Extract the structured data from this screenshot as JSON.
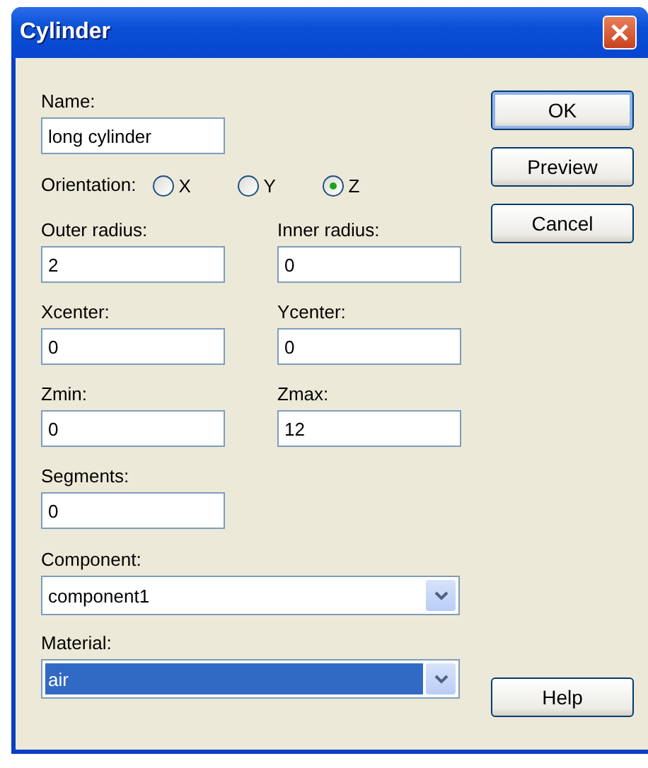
{
  "window": {
    "title": "Cylinder"
  },
  "rows": [
    {
      "kind": "field",
      "label": "Name:",
      "value": "long cylinder"
    },
    {
      "kind": "radio",
      "label": "Orientation:",
      "options": [
        {
          "label": "X",
          "selected": false
        },
        {
          "label": "Y",
          "selected": false
        },
        {
          "label": "Z",
          "selected": true
        }
      ]
    },
    {
      "kind": "pair",
      "fields": [
        {
          "label": "Outer radius:",
          "value": "2"
        },
        {
          "label": "Inner radius:",
          "value": "0"
        }
      ]
    },
    {
      "kind": "pair",
      "fields": [
        {
          "label": "Xcenter:",
          "value": "0"
        },
        {
          "label": "Ycenter:",
          "value": "0"
        }
      ]
    },
    {
      "kind": "pair",
      "fields": [
        {
          "label": "Zmin:",
          "value": "0"
        },
        {
          "label": "Zmax:",
          "value": "12"
        }
      ]
    },
    {
      "kind": "field",
      "label": "Segments:",
      "value": "0"
    },
    {
      "kind": "combo",
      "label": "Component:",
      "value": "component1",
      "focused": false
    },
    {
      "kind": "combo",
      "label": "Material:",
      "value": "air",
      "focused": true
    }
  ],
  "buttons": [
    {
      "label": "OK",
      "default": true
    },
    {
      "label": "Preview",
      "default": false
    },
    {
      "label": "Cancel",
      "default": false
    }
  ],
  "help_button": {
    "label": "Help",
    "default": false
  }
}
